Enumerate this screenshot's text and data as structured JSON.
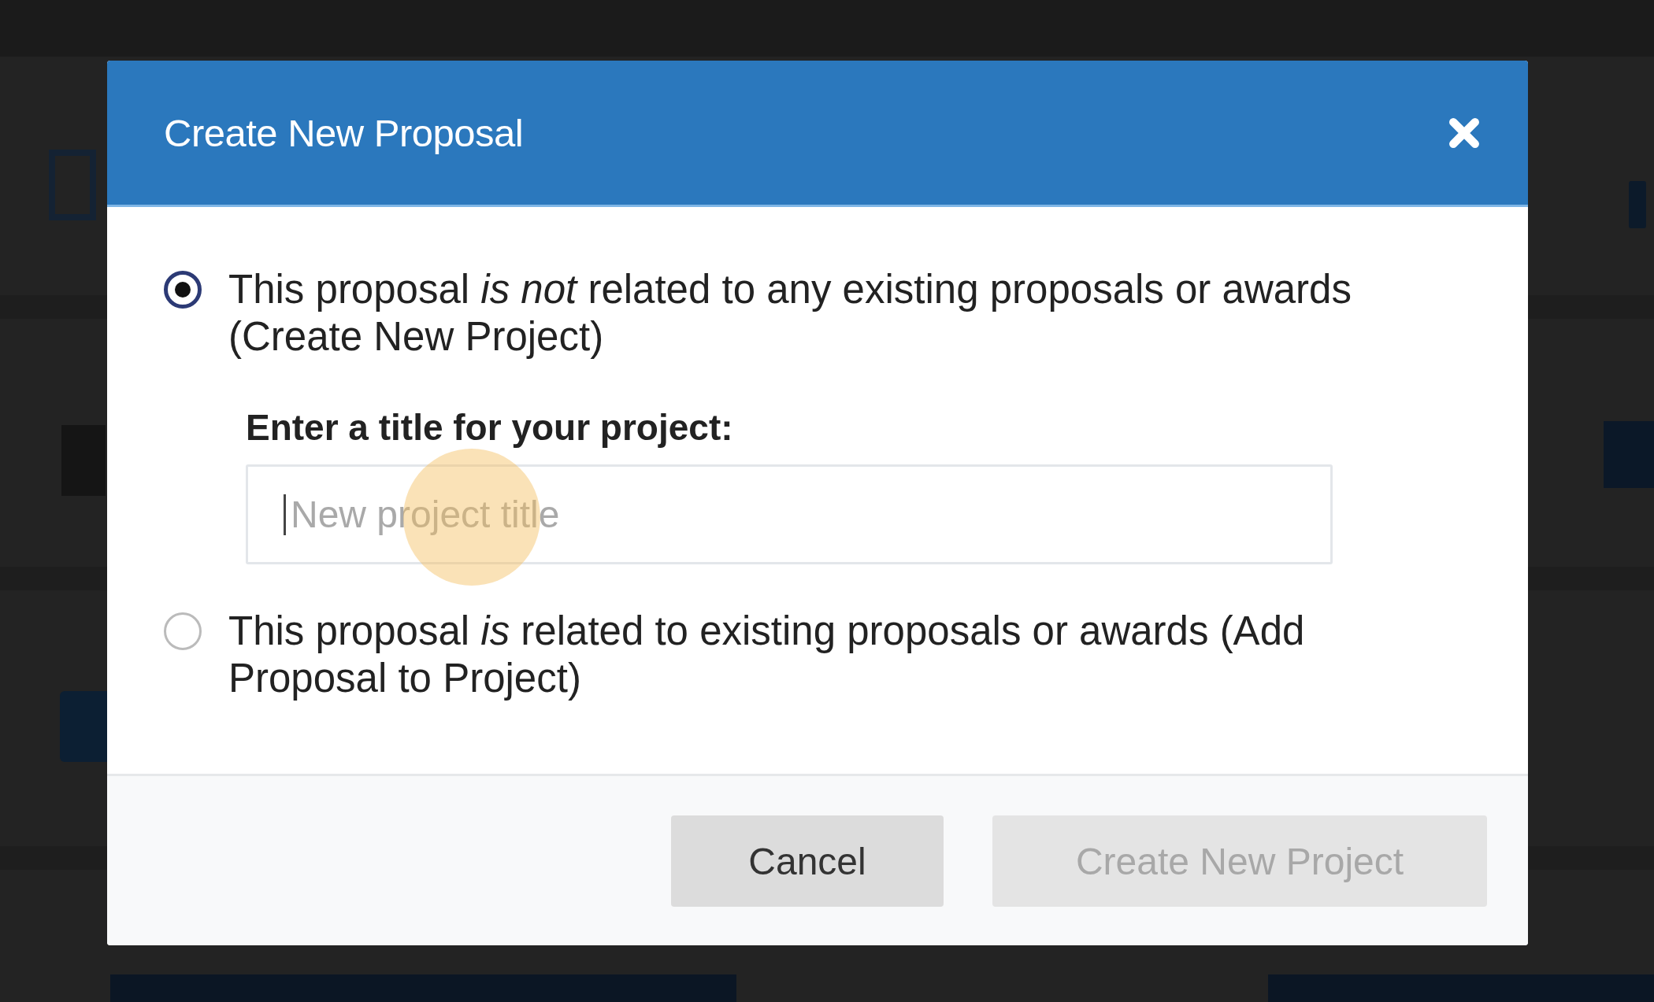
{
  "dialog": {
    "title": "Create New Proposal",
    "options": [
      {
        "text": "This proposal *is not* related to any existing proposals or awards (Create New Project)",
        "selected": true
      },
      {
        "text": "This proposal *is* related to existing proposals or awards (Add Proposal to Project)",
        "selected": false
      }
    ],
    "field": {
      "label": "Enter a title for your project:",
      "placeholder": "New project title"
    },
    "buttons": [
      {
        "label": "Cancel",
        "disabled": false
      },
      {
        "label": "Create New Project",
        "disabled": true
      }
    ]
  }
}
